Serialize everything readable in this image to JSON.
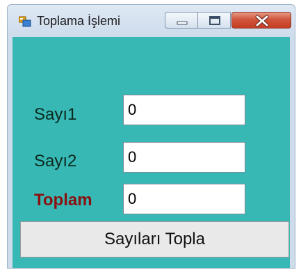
{
  "window": {
    "title": "Toplama İşlemi",
    "icon": "window-form-icon",
    "caption_buttons": [
      "minimize-icon",
      "maximize-icon",
      "close-icon"
    ]
  },
  "form": {
    "background_color": "#38b8b4",
    "fields": [
      {
        "label": "Sayı1",
        "value": "0"
      },
      {
        "label": "Sayı2",
        "value": "0"
      },
      {
        "label": "Toplam",
        "value": "0",
        "label_color": "#8b1010"
      }
    ],
    "button_label": "Sayıları Topla"
  }
}
